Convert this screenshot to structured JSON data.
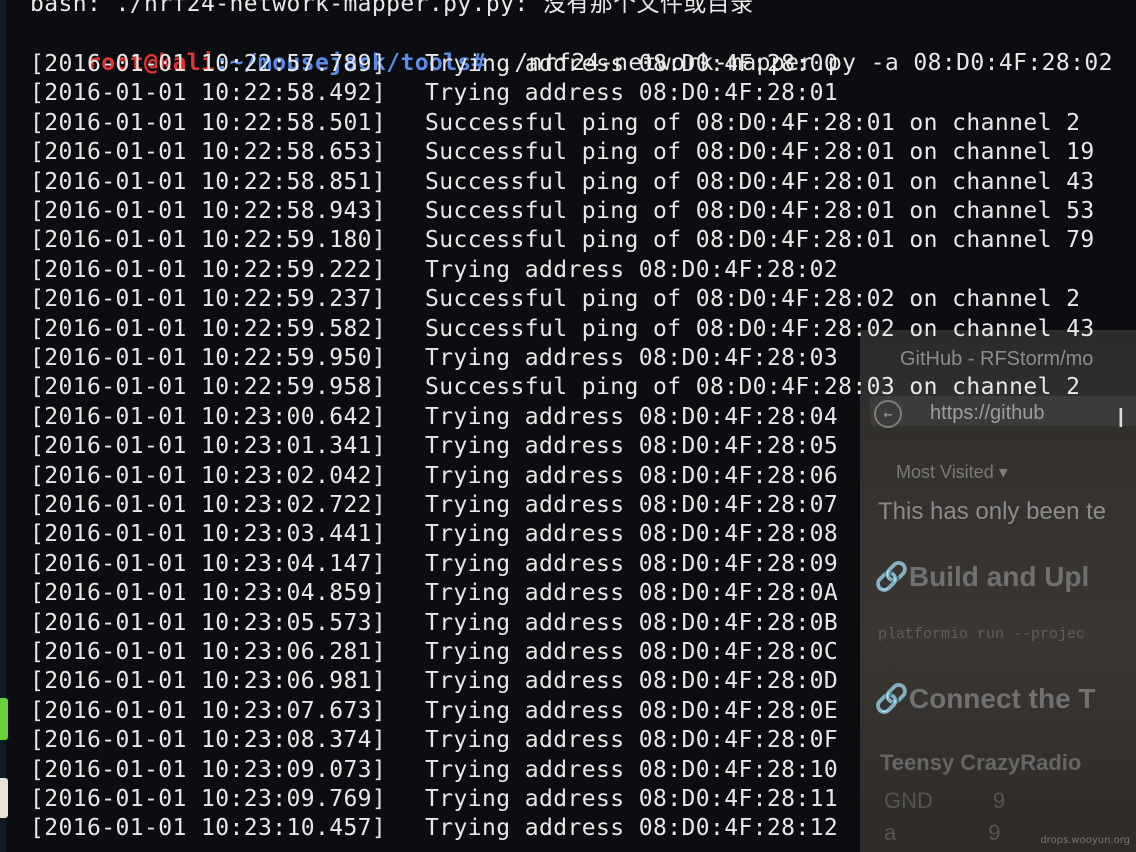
{
  "terminal": {
    "error_line": "bash: ./nrf24-network-mapper.py.py: 没有那个文件或目录",
    "prompt": {
      "user_host": "root@kali",
      "path": ":~/mousejack/tools#",
      "command": " ./nrf24-network-mapper.py -a 08:D0:4F:28:02"
    },
    "log": [
      {
        "ts": "[2016-01-01 10:22:57.789]",
        "msg": "Trying address 08:D0:4F:28:00"
      },
      {
        "ts": "[2016-01-01 10:22:58.492]",
        "msg": "Trying address 08:D0:4F:28:01"
      },
      {
        "ts": "[2016-01-01 10:22:58.501]",
        "msg": "Successful ping of 08:D0:4F:28:01 on channel 2"
      },
      {
        "ts": "[2016-01-01 10:22:58.653]",
        "msg": "Successful ping of 08:D0:4F:28:01 on channel 19"
      },
      {
        "ts": "[2016-01-01 10:22:58.851]",
        "msg": "Successful ping of 08:D0:4F:28:01 on channel 43"
      },
      {
        "ts": "[2016-01-01 10:22:58.943]",
        "msg": "Successful ping of 08:D0:4F:28:01 on channel 53"
      },
      {
        "ts": "[2016-01-01 10:22:59.180]",
        "msg": "Successful ping of 08:D0:4F:28:01 on channel 79"
      },
      {
        "ts": "[2016-01-01 10:22:59.222]",
        "msg": "Trying address 08:D0:4F:28:02"
      },
      {
        "ts": "[2016-01-01 10:22:59.237]",
        "msg": "Successful ping of 08:D0:4F:28:02 on channel 2"
      },
      {
        "ts": "[2016-01-01 10:22:59.582]",
        "msg": "Successful ping of 08:D0:4F:28:02 on channel 43"
      },
      {
        "ts": "[2016-01-01 10:22:59.950]",
        "msg": "Trying address 08:D0:4F:28:03"
      },
      {
        "ts": "[2016-01-01 10:22:59.958]",
        "msg": "Successful ping of 08:D0:4F:28:03 on channel 2"
      },
      {
        "ts": "[2016-01-01 10:23:00.642]",
        "msg": "Trying address 08:D0:4F:28:04"
      },
      {
        "ts": "[2016-01-01 10:23:01.341]",
        "msg": "Trying address 08:D0:4F:28:05"
      },
      {
        "ts": "[2016-01-01 10:23:02.042]",
        "msg": "Trying address 08:D0:4F:28:06"
      },
      {
        "ts": "[2016-01-01 10:23:02.722]",
        "msg": "Trying address 08:D0:4F:28:07"
      },
      {
        "ts": "[2016-01-01 10:23:03.441]",
        "msg": "Trying address 08:D0:4F:28:08"
      },
      {
        "ts": "[2016-01-01 10:23:04.147]",
        "msg": "Trying address 08:D0:4F:28:09"
      },
      {
        "ts": "[2016-01-01 10:23:04.859]",
        "msg": "Trying address 08:D0:4F:28:0A"
      },
      {
        "ts": "[2016-01-01 10:23:05.573]",
        "msg": "Trying address 08:D0:4F:28:0B"
      },
      {
        "ts": "[2016-01-01 10:23:06.281]",
        "msg": "Trying address 08:D0:4F:28:0C"
      },
      {
        "ts": "[2016-01-01 10:23:06.981]",
        "msg": "Trying address 08:D0:4F:28:0D"
      },
      {
        "ts": "[2016-01-01 10:23:07.673]",
        "msg": "Trying address 08:D0:4F:28:0E"
      },
      {
        "ts": "[2016-01-01 10:23:08.374]",
        "msg": "Trying address 08:D0:4F:28:0F"
      },
      {
        "ts": "[2016-01-01 10:23:09.073]",
        "msg": "Trying address 08:D0:4F:28:10"
      },
      {
        "ts": "[2016-01-01 10:23:09.769]",
        "msg": "Trying address 08:D0:4F:28:11"
      },
      {
        "ts": "[2016-01-01 10:23:10.457]",
        "msg": "Trying address 08:D0:4F:28:12"
      }
    ]
  },
  "background_browser": {
    "tab_title": "GitHub - RFStorm/mo",
    "url": "https://github",
    "bookmarks": "Most Visited ▾",
    "intro_text": "This has only been te",
    "heading_build": "Build and Upl",
    "code_line": "platformio run --projec",
    "heading_connect": "Connect the T",
    "table_header": "Teensy CrazyRadio",
    "table_rows": [
      {
        "a": "GND",
        "b": "9"
      },
      {
        "a": "a",
        "b": "9"
      }
    ],
    "watermark": "drops.wooyun.org"
  },
  "colors": {
    "terminal_bg": "#0b0d10",
    "terminal_fg": "#e8e8e8",
    "prompt_user": "#e23232",
    "prompt_path": "#5b8de8"
  }
}
